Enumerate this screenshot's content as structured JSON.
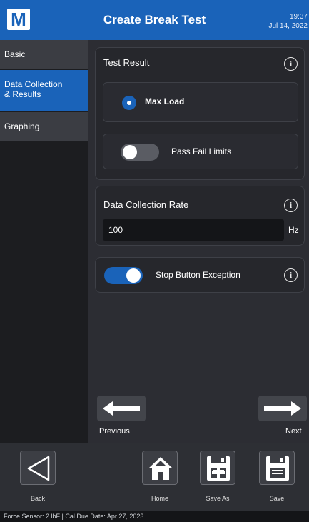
{
  "header": {
    "logo_letter": "M",
    "title": "Create Break Test",
    "time": "19:37",
    "date": "Jul 14, 2022"
  },
  "sidebar": {
    "items": [
      {
        "label": "Basic",
        "active": false
      },
      {
        "label_line1": "Data Collection",
        "label_line2": "& Results",
        "active": true
      },
      {
        "label": "Graphing",
        "active": false
      }
    ]
  },
  "test_result": {
    "label": "Test Result",
    "option": "Max Load",
    "limits_label": "Pass Fail Limits",
    "limits_enabled": false
  },
  "data_collection": {
    "label": "Data Collection Rate",
    "value": "100",
    "unit": "Hz"
  },
  "stop_button": {
    "label": "Stop Button Exception",
    "enabled": true
  },
  "navigation": {
    "previous": "Previous",
    "next": "Next"
  },
  "footer": {
    "back": "Back",
    "home": "Home",
    "save_as": "Save As",
    "save": "Save"
  },
  "status": "Force Sensor: 2 lbF  |  Cal Due Date: Apr 27, 2023",
  "colors": {
    "accent": "#1a63b9",
    "panel": "#2c2d33",
    "sidebar_item": "#3b3d43"
  }
}
